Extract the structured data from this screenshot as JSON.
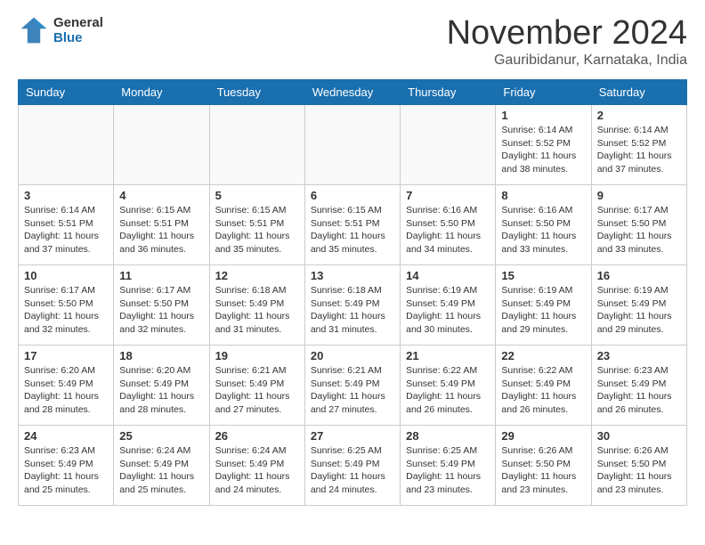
{
  "header": {
    "logo_line1": "General",
    "logo_line2": "Blue",
    "month": "November 2024",
    "location": "Gauribidanur, Karnataka, India"
  },
  "days_of_week": [
    "Sunday",
    "Monday",
    "Tuesday",
    "Wednesday",
    "Thursday",
    "Friday",
    "Saturday"
  ],
  "weeks": [
    [
      {
        "day": "",
        "info": ""
      },
      {
        "day": "",
        "info": ""
      },
      {
        "day": "",
        "info": ""
      },
      {
        "day": "",
        "info": ""
      },
      {
        "day": "",
        "info": ""
      },
      {
        "day": "1",
        "info": "Sunrise: 6:14 AM\nSunset: 5:52 PM\nDaylight: 11 hours and 38 minutes."
      },
      {
        "day": "2",
        "info": "Sunrise: 6:14 AM\nSunset: 5:52 PM\nDaylight: 11 hours and 37 minutes."
      }
    ],
    [
      {
        "day": "3",
        "info": "Sunrise: 6:14 AM\nSunset: 5:51 PM\nDaylight: 11 hours and 37 minutes."
      },
      {
        "day": "4",
        "info": "Sunrise: 6:15 AM\nSunset: 5:51 PM\nDaylight: 11 hours and 36 minutes."
      },
      {
        "day": "5",
        "info": "Sunrise: 6:15 AM\nSunset: 5:51 PM\nDaylight: 11 hours and 35 minutes."
      },
      {
        "day": "6",
        "info": "Sunrise: 6:15 AM\nSunset: 5:51 PM\nDaylight: 11 hours and 35 minutes."
      },
      {
        "day": "7",
        "info": "Sunrise: 6:16 AM\nSunset: 5:50 PM\nDaylight: 11 hours and 34 minutes."
      },
      {
        "day": "8",
        "info": "Sunrise: 6:16 AM\nSunset: 5:50 PM\nDaylight: 11 hours and 33 minutes."
      },
      {
        "day": "9",
        "info": "Sunrise: 6:17 AM\nSunset: 5:50 PM\nDaylight: 11 hours and 33 minutes."
      }
    ],
    [
      {
        "day": "10",
        "info": "Sunrise: 6:17 AM\nSunset: 5:50 PM\nDaylight: 11 hours and 32 minutes."
      },
      {
        "day": "11",
        "info": "Sunrise: 6:17 AM\nSunset: 5:50 PM\nDaylight: 11 hours and 32 minutes."
      },
      {
        "day": "12",
        "info": "Sunrise: 6:18 AM\nSunset: 5:49 PM\nDaylight: 11 hours and 31 minutes."
      },
      {
        "day": "13",
        "info": "Sunrise: 6:18 AM\nSunset: 5:49 PM\nDaylight: 11 hours and 31 minutes."
      },
      {
        "day": "14",
        "info": "Sunrise: 6:19 AM\nSunset: 5:49 PM\nDaylight: 11 hours and 30 minutes."
      },
      {
        "day": "15",
        "info": "Sunrise: 6:19 AM\nSunset: 5:49 PM\nDaylight: 11 hours and 29 minutes."
      },
      {
        "day": "16",
        "info": "Sunrise: 6:19 AM\nSunset: 5:49 PM\nDaylight: 11 hours and 29 minutes."
      }
    ],
    [
      {
        "day": "17",
        "info": "Sunrise: 6:20 AM\nSunset: 5:49 PM\nDaylight: 11 hours and 28 minutes."
      },
      {
        "day": "18",
        "info": "Sunrise: 6:20 AM\nSunset: 5:49 PM\nDaylight: 11 hours and 28 minutes."
      },
      {
        "day": "19",
        "info": "Sunrise: 6:21 AM\nSunset: 5:49 PM\nDaylight: 11 hours and 27 minutes."
      },
      {
        "day": "20",
        "info": "Sunrise: 6:21 AM\nSunset: 5:49 PM\nDaylight: 11 hours and 27 minutes."
      },
      {
        "day": "21",
        "info": "Sunrise: 6:22 AM\nSunset: 5:49 PM\nDaylight: 11 hours and 26 minutes."
      },
      {
        "day": "22",
        "info": "Sunrise: 6:22 AM\nSunset: 5:49 PM\nDaylight: 11 hours and 26 minutes."
      },
      {
        "day": "23",
        "info": "Sunrise: 6:23 AM\nSunset: 5:49 PM\nDaylight: 11 hours and 26 minutes."
      }
    ],
    [
      {
        "day": "24",
        "info": "Sunrise: 6:23 AM\nSunset: 5:49 PM\nDaylight: 11 hours and 25 minutes."
      },
      {
        "day": "25",
        "info": "Sunrise: 6:24 AM\nSunset: 5:49 PM\nDaylight: 11 hours and 25 minutes."
      },
      {
        "day": "26",
        "info": "Sunrise: 6:24 AM\nSunset: 5:49 PM\nDaylight: 11 hours and 24 minutes."
      },
      {
        "day": "27",
        "info": "Sunrise: 6:25 AM\nSunset: 5:49 PM\nDaylight: 11 hours and 24 minutes."
      },
      {
        "day": "28",
        "info": "Sunrise: 6:25 AM\nSunset: 5:49 PM\nDaylight: 11 hours and 23 minutes."
      },
      {
        "day": "29",
        "info": "Sunrise: 6:26 AM\nSunset: 5:50 PM\nDaylight: 11 hours and 23 minutes."
      },
      {
        "day": "30",
        "info": "Sunrise: 6:26 AM\nSunset: 5:50 PM\nDaylight: 11 hours and 23 minutes."
      }
    ]
  ]
}
